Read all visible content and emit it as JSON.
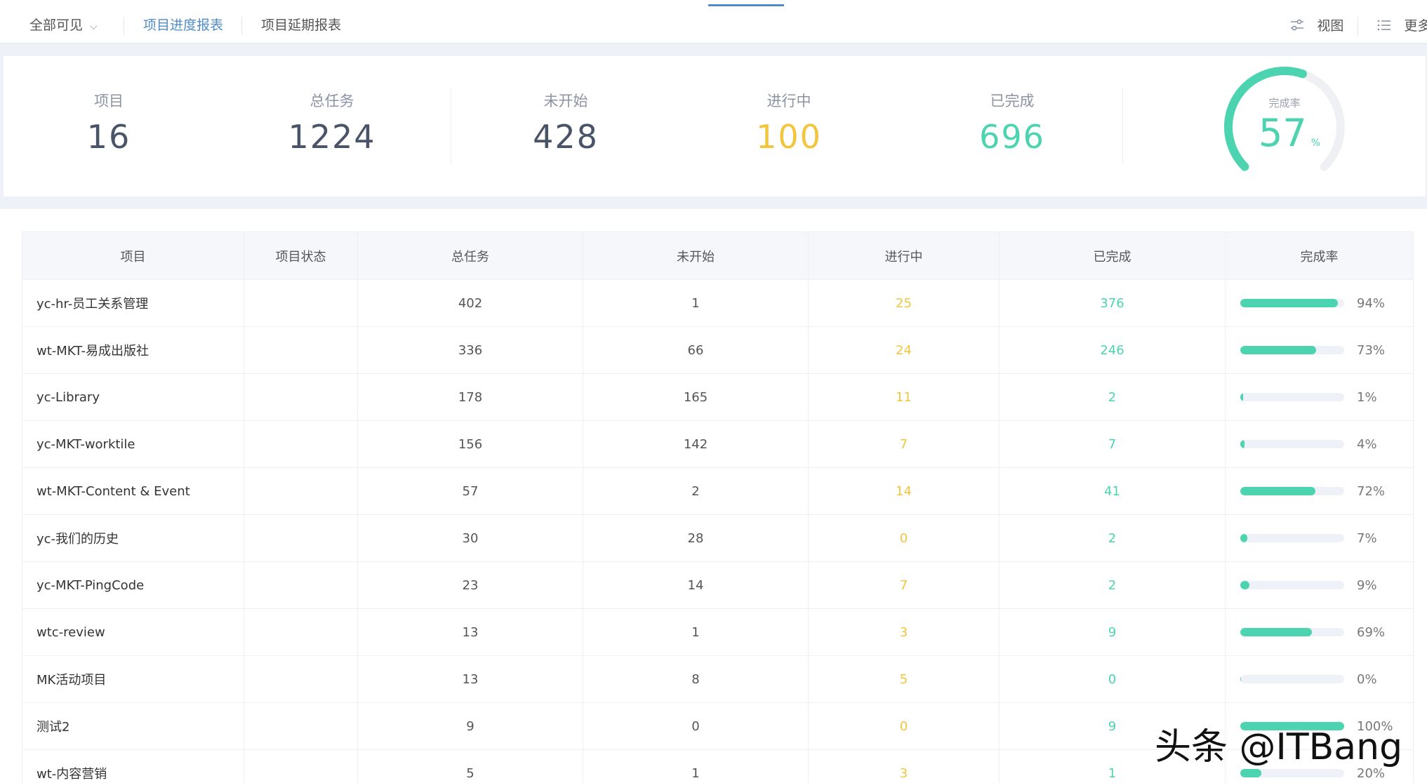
{
  "toolbar": {
    "scope_label": "全部可见",
    "tabs": [
      "项目进度报表",
      "项目延期报表"
    ],
    "view_label": "视图",
    "more_label": "更多"
  },
  "summary": {
    "projects": {
      "label": "项目",
      "value": "16"
    },
    "total": {
      "label": "总任务",
      "value": "1224"
    },
    "not_started": {
      "label": "未开始",
      "value": "428"
    },
    "in_progress": {
      "label": "进行中",
      "value": "100"
    },
    "completed": {
      "label": "已完成",
      "value": "696"
    },
    "completion_rate": {
      "label": "完成率",
      "value": "57",
      "unit": "%",
      "fraction": 0.57
    }
  },
  "colors": {
    "accent": "#4f8cc9",
    "in_progress": "#f2c53d",
    "completed": "#4cd3b0",
    "number": "#4a5468"
  },
  "table": {
    "headers": [
      "项目",
      "项目状态",
      "总任务",
      "未开始",
      "进行中",
      "已完成",
      "完成率"
    ],
    "rows": [
      {
        "name": "yc-hr-员工关系管理",
        "status": "",
        "total": "402",
        "not_started": "1",
        "in_progress": "25",
        "completed": "376",
        "rate": "94%",
        "rate_value": 94
      },
      {
        "name": "wt-MKT-易成出版社",
        "status": "",
        "total": "336",
        "not_started": "66",
        "in_progress": "24",
        "completed": "246",
        "rate": "73%",
        "rate_value": 73
      },
      {
        "name": "yc-Library",
        "status": "",
        "total": "178",
        "not_started": "165",
        "in_progress": "11",
        "completed": "2",
        "rate": "1%",
        "rate_value": 1
      },
      {
        "name": "yc-MKT-worktile",
        "status": "",
        "total": "156",
        "not_started": "142",
        "in_progress": "7",
        "completed": "7",
        "rate": "4%",
        "rate_value": 4
      },
      {
        "name": "wt-MKT-Content & Event",
        "status": "",
        "total": "57",
        "not_started": "2",
        "in_progress": "14",
        "completed": "41",
        "rate": "72%",
        "rate_value": 72
      },
      {
        "name": "yc-我们的历史",
        "status": "",
        "total": "30",
        "not_started": "28",
        "in_progress": "0",
        "completed": "2",
        "rate": "7%",
        "rate_value": 7
      },
      {
        "name": "yc-MKT-PingCode",
        "status": "",
        "total": "23",
        "not_started": "14",
        "in_progress": "7",
        "completed": "2",
        "rate": "9%",
        "rate_value": 9
      },
      {
        "name": "wtc-review",
        "status": "",
        "total": "13",
        "not_started": "1",
        "in_progress": "3",
        "completed": "9",
        "rate": "69%",
        "rate_value": 69
      },
      {
        "name": "MK活动项目",
        "status": "",
        "total": "13",
        "not_started": "8",
        "in_progress": "5",
        "completed": "0",
        "rate": "0%",
        "rate_value": 0
      },
      {
        "name": "测试2",
        "status": "",
        "total": "9",
        "not_started": "0",
        "in_progress": "0",
        "completed": "9",
        "rate": "100%",
        "rate_value": 100
      },
      {
        "name": "wt-内容营销",
        "status": "",
        "total": "5",
        "not_started": "1",
        "in_progress": "3",
        "completed": "1",
        "rate": "20%",
        "rate_value": 20
      }
    ]
  },
  "watermark": "头条 @ITBang"
}
